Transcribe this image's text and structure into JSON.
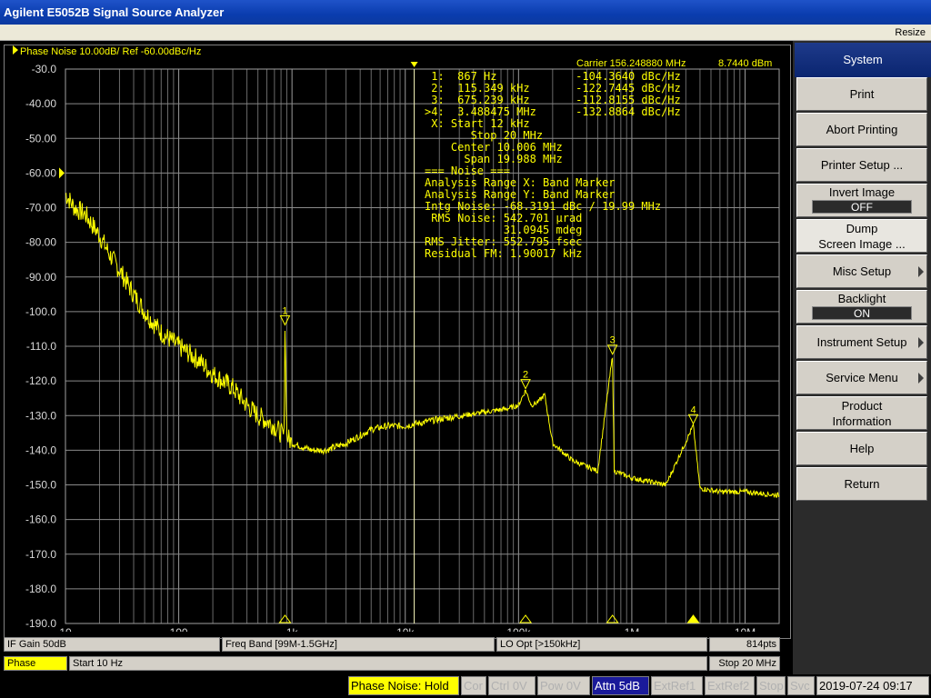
{
  "window": {
    "title": "Agilent E5052B Signal Source Analyzer",
    "resize_label": "Resize"
  },
  "trace": {
    "title": "Phase Noise 10.00dB/ Ref -60.00dBc/Hz",
    "carrier": "Carrier 156.248880 MHz",
    "carrier_level": "8.7440 dBm"
  },
  "info_lines": [
    " 1:  867 Hz            -104.3640 dBc/Hz",
    " 2:  115.349 kHz       -122.7445 dBc/Hz",
    " 3:  675.239 kHz       -112.8155 dBc/Hz",
    ">4:  3.488475 MHz      -132.8864 dBc/Hz",
    " X: Start 12 kHz",
    "       Stop 20 MHz",
    "    Center 10.006 MHz",
    "      Span 19.988 MHz",
    "=== Noise ===",
    "Analysis Range X: Band Marker",
    "Analysis Range Y: Band Marker",
    "Intg Noise: -68.3191 dBc / 19.99 MHz",
    " RMS Noise: 542.701 µrad",
    "            31.0945 mdeg",
    "RMS Jitter: 552.795 fsec",
    "Residual FM: 1.90017 kHz"
  ],
  "chart_data": {
    "type": "line",
    "title": "Phase Noise 10.00dB/ Ref -60.00dBc/Hz",
    "xscale": "log",
    "xlim": [
      10,
      20000000
    ],
    "ylim": [
      -190,
      -30
    ],
    "grid": true,
    "y_ticks": [
      "-30.0",
      "-40.00",
      "-50.00",
      "-60.00",
      "-70.00",
      "-80.00",
      "-90.00",
      "-100.0",
      "-110.0",
      "-120.0",
      "-130.0",
      "-140.0",
      "-150.0",
      "-160.0",
      "-170.0",
      "-180.0",
      "-190.0"
    ],
    "x_ticks": [
      {
        "value": 10,
        "label": "10"
      },
      {
        "value": 100,
        "label": "100"
      },
      {
        "value": 1000,
        "label": "1k"
      },
      {
        "value": 10000,
        "label": "10k"
      },
      {
        "value": 100000,
        "label": "100k"
      },
      {
        "value": 1000000,
        "label": "1M"
      },
      {
        "value": 10000000,
        "label": "10M"
      }
    ],
    "series": [
      {
        "color": "#ffff00",
        "x": [
          10,
          12,
          15,
          20,
          25,
          30,
          40,
          50,
          70,
          100,
          150,
          200,
          300,
          400,
          500,
          700,
          850,
          867,
          900,
          1000,
          1500,
          2000,
          3000,
          5000,
          7000,
          10000,
          20000,
          50000,
          80000,
          100000,
          115349,
          130000,
          150000,
          170000,
          200000,
          300000,
          500000,
          675239,
          700000,
          1000000,
          2000000,
          3488475,
          4000000,
          6000000,
          10000000,
          20000000
        ],
        "y": [
          -66,
          -70,
          -72,
          -78,
          -84,
          -88,
          -95,
          -100,
          -106,
          -110,
          -114,
          -118,
          -122,
          -127,
          -130,
          -133,
          -136,
          -104.4,
          -136,
          -138,
          -140,
          -140,
          -138,
          -134,
          -133,
          -133,
          -131,
          -129,
          -128,
          -127,
          -122.7,
          -127,
          -126,
          -124,
          -138,
          -143,
          -146,
          -112.8,
          -146,
          -148,
          -150,
          -132.9,
          -151,
          -152,
          -152,
          -153
        ]
      }
    ],
    "markers": [
      {
        "id": "1",
        "x": 867,
        "y": -104.364
      },
      {
        "id": "2",
        "x": 115349,
        "y": -122.7445
      },
      {
        "id": "3",
        "x": 675239,
        "y": -112.8155
      },
      {
        "id": "4",
        "x": 3488475,
        "y": -132.8864,
        "active": true
      }
    ],
    "band_marker": {
      "start": 12000,
      "stop": 20000000
    }
  },
  "status1": {
    "if_gain": "IF Gain 50dB",
    "freq_band": "Freq Band [99M-1.5GHz]",
    "lo_opt": "LO Opt [>150kHz]",
    "points": "814pts"
  },
  "status2": {
    "meas": "Phase Noise",
    "start": "Start 10 Hz",
    "stop": "Stop 20 MHz"
  },
  "bottom": {
    "phase_noise_hold": "Phase Noise: Hold",
    "cor": "Cor",
    "ctrl": "Ctrl  0V",
    "pow": "Pow  0V",
    "attn": "Attn 5dB",
    "extref1": "ExtRef1",
    "extref2": "ExtRef2",
    "stop": "Stop",
    "svc": "Svc",
    "datetime": "2019-07-24 09:17"
  },
  "softkeys": {
    "title": "System",
    "print": "Print",
    "abort_printing": "Abort Printing",
    "printer_setup": "Printer Setup ...",
    "invert_image": "Invert Image",
    "invert_image_value": "OFF",
    "dump_line1": "Dump",
    "dump_line2": "Screen Image ...",
    "misc_setup": "Misc Setup",
    "backlight": "Backlight",
    "backlight_value": "ON",
    "instrument_setup": "Instrument Setup",
    "service_menu": "Service Menu",
    "product_line1": "Product",
    "product_line2": "Information",
    "help": "Help",
    "return": "Return"
  }
}
